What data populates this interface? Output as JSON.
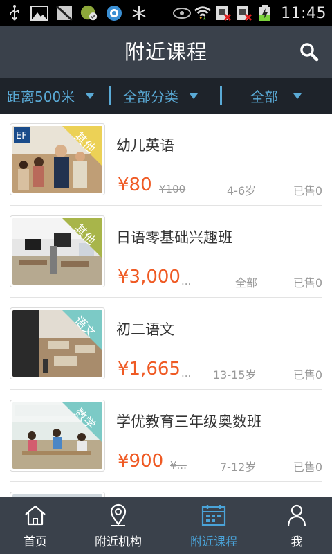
{
  "status_bar": {
    "time": "11:45",
    "icons": [
      "usb-icon",
      "image-icon",
      "no-sim-icon",
      "app-icon",
      "browser-icon",
      "snowflake-icon",
      "eye-icon",
      "wifi-icon",
      "sim-x-icon",
      "sim-x-icon",
      "battery-charging-icon"
    ]
  },
  "header": {
    "title": "附近课程",
    "search_icon": "search-icon"
  },
  "filters": [
    {
      "label": "距离500米"
    },
    {
      "label": "全部分类"
    },
    {
      "label": "全部"
    }
  ],
  "colors": {
    "header_bg": "#3a414b",
    "filter_bg": "#1e232a",
    "accent_blue": "#5aaad6",
    "price_orange": "#ef5a24",
    "tag_yellow": "#e8c94a",
    "tag_olive": "#a9b74a",
    "tag_teal": "#7cc7c6"
  },
  "courses": [
    {
      "name": "幼儿英语",
      "tag": "其他",
      "tag_color": "#ecd156",
      "price": "¥80",
      "old_price": "¥100",
      "age": "4-6岁",
      "sold": "已售0"
    },
    {
      "name": "日语零基础兴趣班",
      "tag": "其他",
      "tag_color": "#a8b54a",
      "price": "¥3,000",
      "old_price": "...",
      "age": "全部",
      "sold": "已售0"
    },
    {
      "name": "初二语文",
      "tag": "语文",
      "tag_color": "#7ccac6",
      "price": "¥1,665",
      "old_price": "...",
      "age": "13-15岁",
      "sold": "已售0"
    },
    {
      "name": "学优教育三年级奥数班",
      "tag": "数学",
      "tag_color": "#7ccac6",
      "price": "¥900",
      "old_price": "¥...",
      "age": "7-12岁",
      "sold": "已售0"
    }
  ],
  "bottom_nav": [
    {
      "label": "首页",
      "icon": "home-icon"
    },
    {
      "label": "附近机构",
      "icon": "location-pin-icon"
    },
    {
      "label": "附近课程",
      "icon": "calendar-icon",
      "active": true
    },
    {
      "label": "我",
      "icon": "user-icon"
    }
  ]
}
